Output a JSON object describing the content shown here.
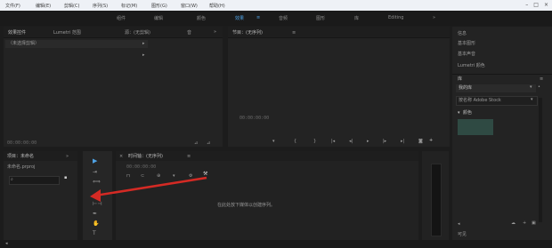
{
  "window": {
    "menu": [
      "文件(F)",
      "编辑(E)",
      "剪辑(C)",
      "序列(S)",
      "标记(M)",
      "图形(G)",
      "窗口(W)",
      "帮助(H)"
    ],
    "controls": [
      "–",
      "□",
      "×"
    ]
  },
  "workspaces": {
    "tabs": [
      "组件",
      "编辑",
      "颜色",
      "效果",
      "音频",
      "图形",
      "库",
      "Editing"
    ],
    "active_index": 3
  },
  "source_panel": {
    "tabs": [
      "效果控件",
      "Lumetri 范围",
      "源：(无剪辑)",
      "音"
    ],
    "dropdown_placeholder": "（未选择剪辑）",
    "footer": "00:00:00:00"
  },
  "program_panel": {
    "title": "节目：(无序列)",
    "timecode": "00:00:00:00"
  },
  "right_panel": {
    "items": [
      "信息",
      "基本图形",
      "基本声音",
      "Lumetri 颜色"
    ],
    "section": "库",
    "library": "我的库",
    "library_sub": "按名称 Adobe Stock",
    "group": "颜色",
    "swatch_color": "#2f4a43",
    "footer": "可见"
  },
  "project_panel": {
    "title": "项目：未命名",
    "subtitle": "未命名.prproj",
    "search_placeholder": ""
  },
  "timeline_panel": {
    "title": "时间轴：(无序列)",
    "timecode": "00:00:00:00",
    "empty_message": "在此处放下媒体以创建序列。"
  },
  "colors": {
    "accent": "#4fa3e6",
    "arrow": "#d42a24"
  }
}
